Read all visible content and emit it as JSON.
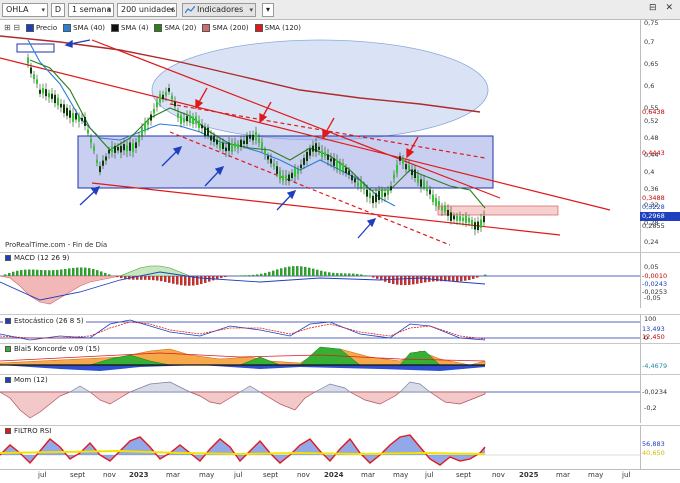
{
  "toolbar": {
    "symbol": "OHLA",
    "mode": "D",
    "period": "1 semana",
    "units": "200 unidades",
    "indicators_button": "Indicadores",
    "window_controls": "⊟ ✕"
  },
  "legend": [
    {
      "label": "Precio",
      "color": "#1e3fbf"
    },
    {
      "label": "SMA (40)",
      "color": "#2a7fd6"
    },
    {
      "label": "SMA (4)",
      "color": "#111111"
    },
    {
      "label": "SMA (20)",
      "color": "#2e7d1f"
    },
    {
      "label": "SMA (200)",
      "color": "#d46a6a"
    },
    {
      "label": "SMA (120)",
      "color": "#e01919"
    }
  ],
  "watermark": "ProRealTime.com - Fin de Día",
  "price_axis": {
    "ticks": [
      "0,75",
      "0,7",
      "0,65",
      "0,6",
      "0,55",
      "0,52",
      "0,48",
      "0,44",
      "0,4",
      "0,36",
      "0,32",
      "0,28",
      "0,24"
    ],
    "tags": [
      {
        "text": "0,6438",
        "color": "#c00000",
        "bg": "#ffffff"
      },
      {
        "text": "0,4443",
        "color": "#c00000",
        "bg": "#ffffff"
      },
      {
        "text": "0,3488",
        "color": "#c00000",
        "bg": "#ffffff"
      },
      {
        "text": "0,3228",
        "color": "#1e3fbf",
        "bg": "#ffffff"
      },
      {
        "text": "0,2968",
        "color": "#ffffff",
        "bg": "#1e3fbf"
      },
      {
        "text": "0,2855",
        "color": "#333333",
        "bg": "#ffffff"
      }
    ]
  },
  "panes": {
    "macd": {
      "label": "MACD (12 26 9)",
      "ticks": [
        "0,05",
        "-0,05"
      ],
      "tags": [
        "-0,0010",
        "-0,0243",
        "-0,0253"
      ]
    },
    "stoch": {
      "label": "Estocástico (26 8 5)",
      "ticks": [
        "100",
        "0"
      ],
      "tags": [
        "13,493",
        "12,450"
      ]
    },
    "koncorde": {
      "label": "Blai5 Koncorde v.09 (15)",
      "tags": [
        "-4,4679"
      ]
    },
    "mom": {
      "label": "Mom (12)",
      "ticks": [
        "-0,2"
      ],
      "tags": [
        "-0,0234"
      ]
    },
    "rsi": {
      "label": "FILTRO RSI",
      "tags": [
        "56,883",
        "40,650"
      ]
    }
  },
  "x_axis": [
    "jul",
    "sept",
    "nov",
    "2023",
    "mar",
    "may",
    "jul",
    "sept",
    "nov",
    "2024",
    "mar",
    "may",
    "jul",
    "sept",
    "nov",
    "2025",
    "mar",
    "may",
    "jul"
  ]
}
